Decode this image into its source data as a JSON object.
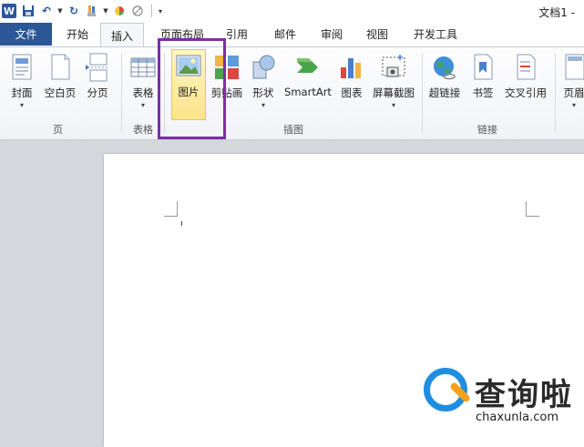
{
  "titlebar": {
    "app_icon_letter": "W",
    "document_title": "文档1 -"
  },
  "tabs": {
    "file": "文件",
    "items": [
      "开始",
      "插入",
      "页面布局",
      "引用",
      "邮件",
      "审阅",
      "视图",
      "开发工具"
    ],
    "active": "插入"
  },
  "ribbon": {
    "pages_group": {
      "label": "页",
      "cover": "封面",
      "blank_page": "空白页",
      "page_break": "分页"
    },
    "table_group": {
      "label": "表格",
      "table": "表格"
    },
    "illustrations_group": {
      "label": "插图",
      "picture": "图片",
      "clip_art": "剪贴画",
      "shapes": "形状",
      "smartart": "SmartArt",
      "chart": "图表",
      "screenshot": "屏幕截图"
    },
    "links_group": {
      "label": "链接",
      "hyperlink": "超链接",
      "bookmark": "书签",
      "cross_reference": "交叉引用"
    },
    "header_footer_group": {
      "header_partial": "页眉"
    }
  },
  "watermark": {
    "brand": "查询啦",
    "url": "chaxunla.com"
  },
  "colors": {
    "file_tab": "#2b5797",
    "highlight": "#fbe48a",
    "annotation_box": "#7b2ea5",
    "watermark_blue": "#1f8de0",
    "watermark_orange": "#f4a21c"
  }
}
